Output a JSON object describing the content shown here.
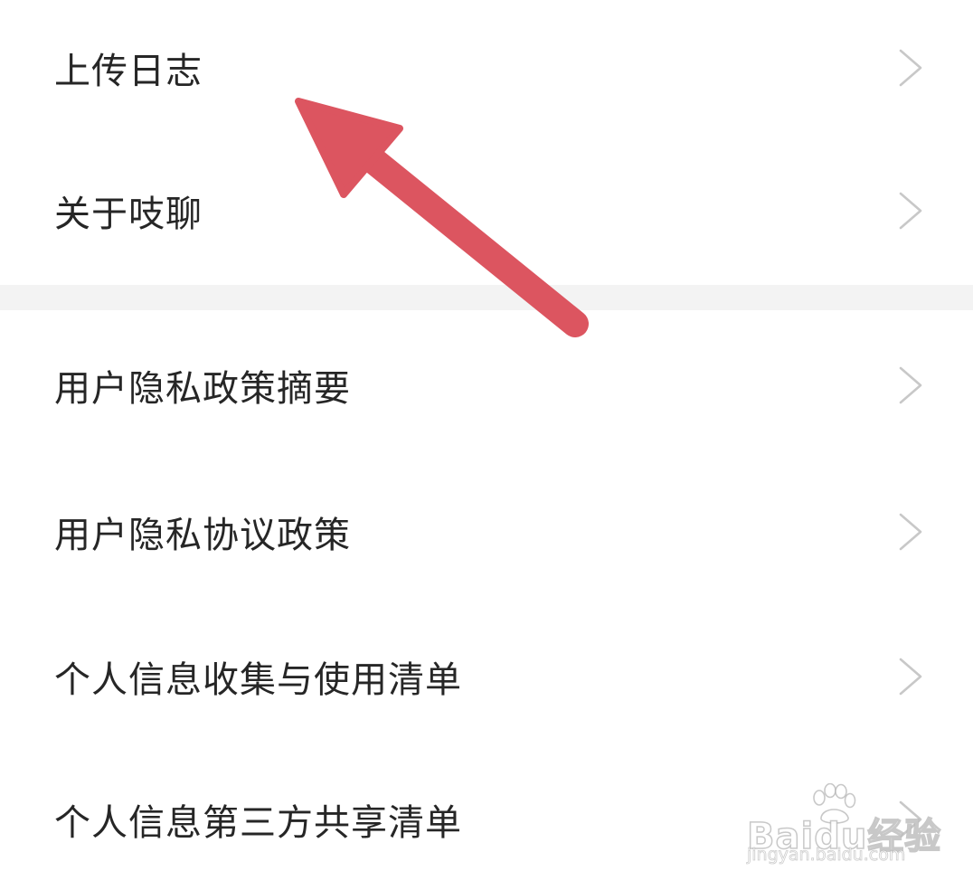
{
  "settings": {
    "group1": [
      {
        "label": "上传日志"
      },
      {
        "label": "关于吱聊"
      }
    ],
    "group2": [
      {
        "label": "用户隐私政策摘要"
      },
      {
        "label": "用户隐私协议政策"
      },
      {
        "label": "个人信息收集与使用清单"
      },
      {
        "label": "个人信息第三方共享清单"
      }
    ]
  },
  "icons": {
    "row_chevron": "chevron-right-icon",
    "annotation": "arrow-annotation-icon"
  },
  "colors": {
    "label_text": "#262626",
    "chevron": "#c8c8c8",
    "section_gap": "#f3f3f3",
    "annotation_arrow": "#dc5560"
  },
  "watermark": {
    "brand": "Baidu经验",
    "url": "jingyan.baidu.com"
  }
}
